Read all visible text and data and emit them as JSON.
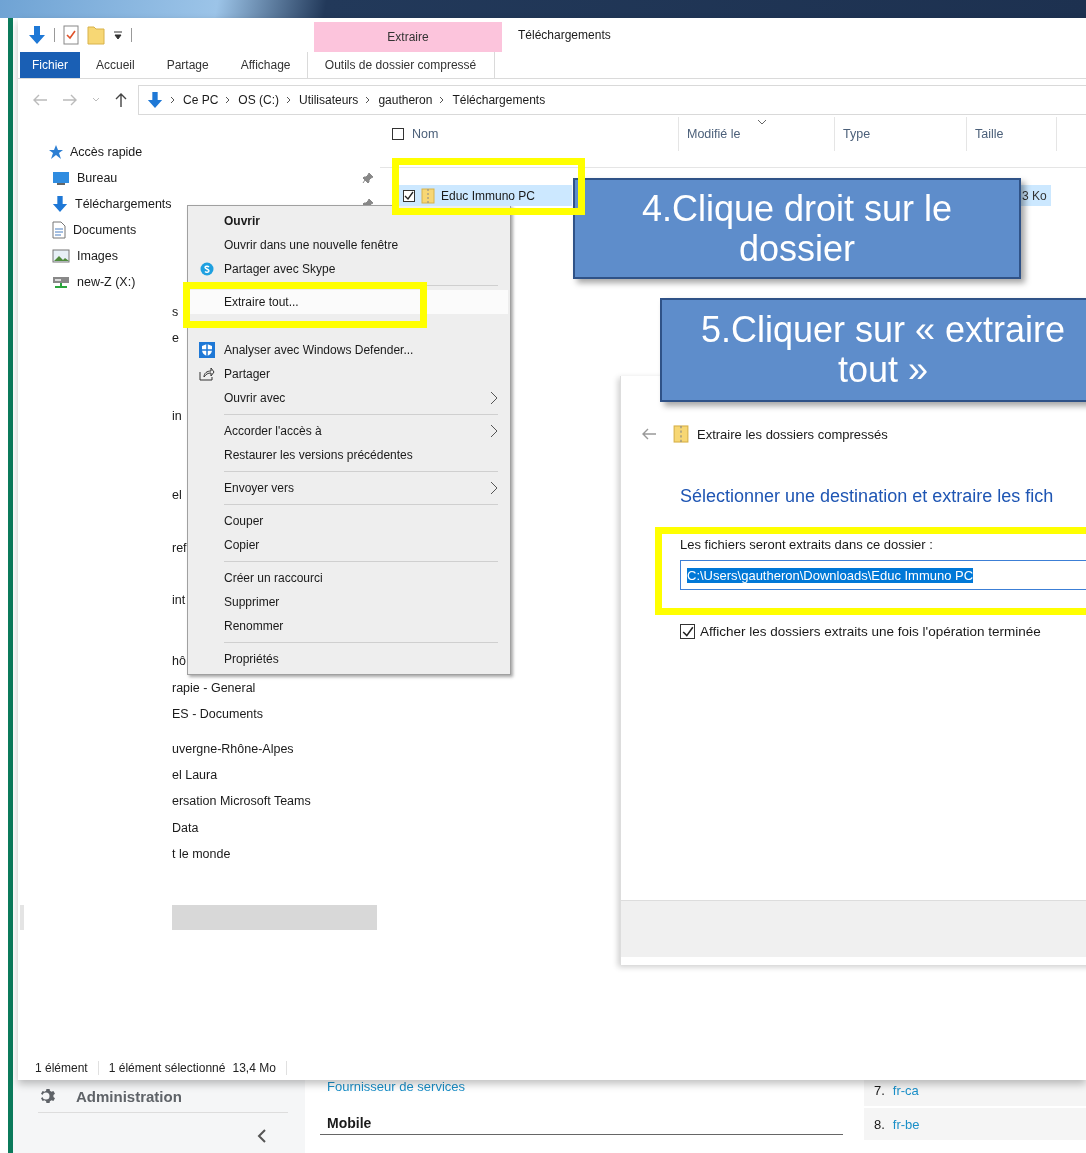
{
  "background_page": {
    "sidebar_item": "Administration",
    "link": "Fournisseur de services",
    "section": "Mobile",
    "list": [
      {
        "number": "7.",
        "label": "fr-ca"
      },
      {
        "number": "8.",
        "label": "fr-be"
      }
    ]
  },
  "explorer": {
    "context_group": "Extraire",
    "title": "Téléchargements",
    "ribbon_tabs": [
      {
        "label": "Fichier",
        "selected": true,
        "kind": "file"
      },
      {
        "label": "Accueil",
        "selected": false,
        "kind": "standard"
      },
      {
        "label": "Partage",
        "selected": false,
        "kind": "standard"
      },
      {
        "label": "Affichage",
        "selected": false,
        "kind": "standard"
      },
      {
        "label": "Outils de dossier compressé",
        "selected": false,
        "kind": "contextual"
      }
    ],
    "breadcrumb": [
      "Ce PC",
      "OS (C:)",
      "Utilisateurs",
      "gautheron",
      "Téléchargements"
    ],
    "quick_access": "Accès rapide",
    "nav_items": [
      {
        "label": "Bureau",
        "kind": "desktop",
        "pinned": true
      },
      {
        "label": "Téléchargements",
        "kind": "download",
        "pinned": true
      },
      {
        "label": "Documents",
        "kind": "documents"
      },
      {
        "label": "Images",
        "kind": "images"
      },
      {
        "label": "new-Z (X:)",
        "kind": "drive"
      }
    ],
    "nav_fragments": [
      "s",
      "e",
      "in",
      "el",
      "ref",
      "int",
      "hô",
      "rapie - General",
      "ES - Documents",
      "uvergne-Rhône-Alpes",
      "el Laura",
      "ersation Microsoft Teams",
      "Data",
      "t le monde"
    ],
    "columns": [
      {
        "label": "Nom"
      },
      {
        "label": "Modifié le",
        "sorted": true
      },
      {
        "label": "Type"
      },
      {
        "label": "Taille"
      }
    ],
    "select_all_checked": false,
    "files": [
      {
        "name": "Educ Immuno PC",
        "size": "3 Ko",
        "checked": true,
        "selected": true
      }
    ],
    "status": [
      "1 élément",
      "1 élément sélectionné",
      "13,4 Mo"
    ]
  },
  "context_menu": [
    {
      "kind": "default",
      "label": "Ouvrir",
      "selected": false
    },
    {
      "kind": "item",
      "label": "Ouvrir dans une nouvelle fenêtre",
      "selected": false
    },
    {
      "kind": "item",
      "label": "Partager avec Skype",
      "selected": false
    },
    {
      "kind": "separator"
    },
    {
      "kind": "item",
      "label": "Extraire tout...",
      "selected": true
    },
    {
      "kind": "item",
      "label": "Analyser avec Windows Defender...",
      "selected": false
    },
    {
      "kind": "item",
      "label": "Partager",
      "selected": false
    },
    {
      "kind": "submenu",
      "label": "Ouvrir avec",
      "selected": false
    },
    {
      "kind": "separator"
    },
    {
      "kind": "submenu",
      "label": "Accorder l'accès à",
      "selected": false
    },
    {
      "kind": "item",
      "label": "Restaurer les versions précédentes",
      "selected": false
    },
    {
      "kind": "separator"
    },
    {
      "kind": "submenu",
      "label": "Envoyer vers",
      "selected": false
    },
    {
      "kind": "separator"
    },
    {
      "kind": "item",
      "label": "Couper",
      "selected": false
    },
    {
      "kind": "item",
      "label": "Copier",
      "selected": false
    },
    {
      "kind": "separator"
    },
    {
      "kind": "item",
      "label": "Créer un raccourci",
      "selected": false
    },
    {
      "kind": "item",
      "label": "Supprimer",
      "selected": false
    },
    {
      "kind": "item",
      "label": "Renommer",
      "selected": false
    },
    {
      "kind": "separator"
    },
    {
      "kind": "item",
      "label": "Propriétés",
      "selected": false
    }
  ],
  "extract_dialog": {
    "title": "Extraire les dossiers compressés",
    "heading": "Sélectionner une destination et extraire les fich",
    "label": "Les fichiers seront extraits dans ce dossier :",
    "path": "C:\\Users\\gautheron\\Downloads\\Educ Immuno PC",
    "show_when_done": {
      "label": "Afficher les dossiers extraits une fois l'opération terminée",
      "checked": true
    }
  },
  "callouts": [
    {
      "text": "4.Clique droit sur le dossier"
    },
    {
      "text": "5.Cliquer sur « extraire tout »"
    }
  ]
}
